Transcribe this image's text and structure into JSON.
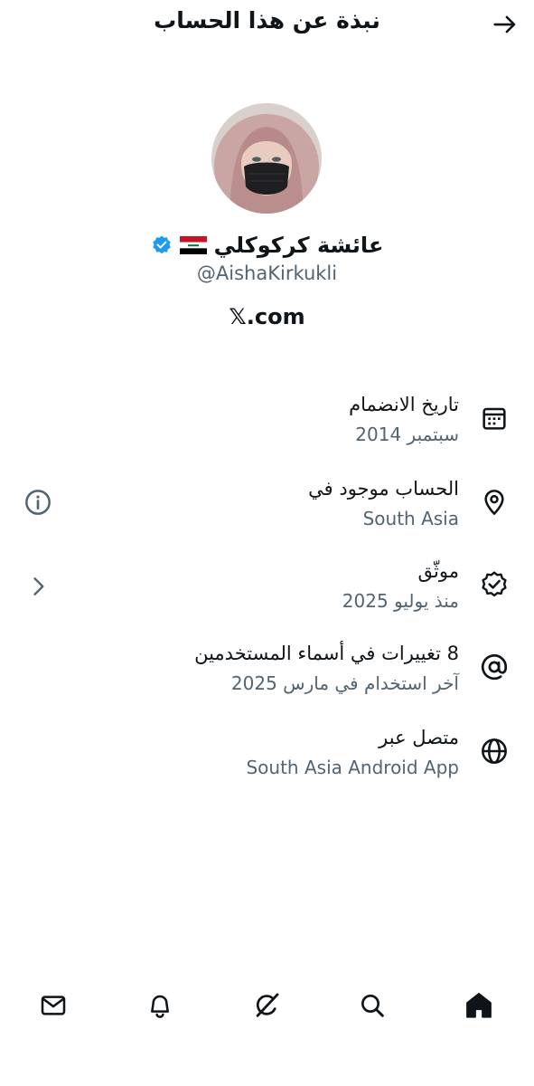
{
  "header": {
    "title": "نبذة عن هذا الحساب",
    "back_icon": "arrow-right-icon"
  },
  "profile": {
    "display_name": "عائشة كركوكلي",
    "flag": "iraq-flag",
    "verified_icon": "verified-badge-icon",
    "handle": "@AishaKirkukli",
    "site": "𝕏.com"
  },
  "info_rows": [
    {
      "icon": "calendar-icon",
      "title": "تاريخ الانضمام",
      "subtitle": "سبتمبر 2014"
    },
    {
      "icon": "location-pin-icon",
      "title": "الحساب موجود في",
      "subtitle": "South Asia",
      "aside_icon": "info-icon"
    },
    {
      "icon": "verified-check-icon",
      "title": "موثّق",
      "subtitle": "منذ يوليو 2025",
      "aside_icon": "chevron-right-icon"
    },
    {
      "icon": "at-sign-icon",
      "title": "8 تغييرات في أسماء المستخدمين",
      "subtitle": "آخر استخدام في مارس 2025"
    },
    {
      "icon": "globe-icon",
      "title": "متصل عبر",
      "subtitle": "South Asia Android App"
    }
  ],
  "bottom_nav": [
    {
      "name": "mail-icon"
    },
    {
      "name": "bell-icon"
    },
    {
      "name": "grok-icon"
    },
    {
      "name": "search-icon"
    },
    {
      "name": "home-icon"
    }
  ],
  "colors": {
    "text_primary": "#0f1419",
    "text_secondary": "#536471",
    "verified_blue": "#1d9bf0",
    "background": "#ffffff"
  }
}
